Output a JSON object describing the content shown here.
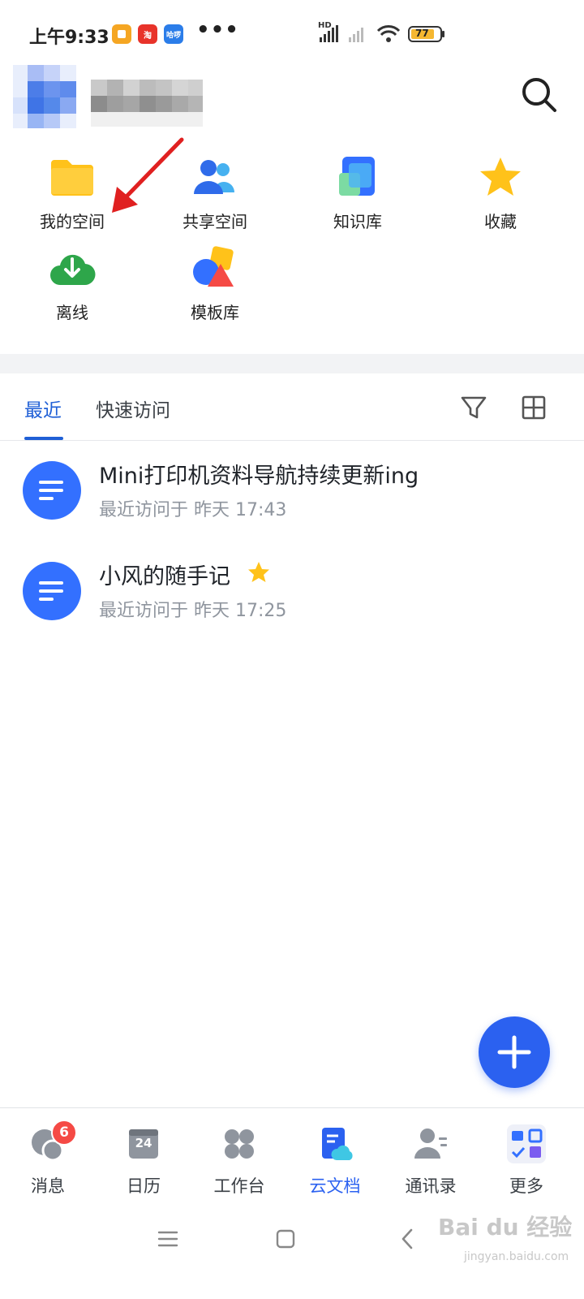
{
  "status_bar": {
    "time": "上午9:33",
    "apps": [
      "notes-app-icon",
      "taobao-app-icon",
      "haluo-app-icon"
    ],
    "app_labels": [
      "",
      "淘",
      "哈啰"
    ],
    "more": "•••",
    "network_label": "HD",
    "battery": "77"
  },
  "header": {
    "avatar_icon": "avatar-pixelated",
    "username_icon": "username-pixelated"
  },
  "shortcuts": [
    {
      "label": "我的空间",
      "icon": "folder-icon"
    },
    {
      "label": "共享空间",
      "icon": "people-icon"
    },
    {
      "label": "知识库",
      "icon": "knowledge-base-icon"
    },
    {
      "label": "收藏",
      "icon": "star-icon"
    },
    {
      "label": "离线",
      "icon": "cloud-download-icon"
    },
    {
      "label": "模板库",
      "icon": "template-icon"
    }
  ],
  "tabs": {
    "recent": "最近",
    "quick_access": "快速访问"
  },
  "documents": [
    {
      "title": "Mini打印机资料导航持续更新ing",
      "subtitle": "最近访问于  昨天 17:43",
      "starred": false
    },
    {
      "title": "小风的随手记",
      "subtitle": "最近访问于  昨天 17:25",
      "starred": true
    }
  ],
  "bottom_nav": [
    {
      "label": "消息",
      "icon": "chat-icon",
      "badge": "6"
    },
    {
      "label": "日历",
      "icon": "calendar-icon",
      "day": "24"
    },
    {
      "label": "工作台",
      "icon": "workbench-icon"
    },
    {
      "label": "云文档",
      "icon": "cloud-doc-icon",
      "active": true
    },
    {
      "label": "通讯录",
      "icon": "contacts-icon"
    },
    {
      "label": "更多",
      "icon": "more-apps-icon"
    }
  ],
  "watermark": {
    "brand": "Bai du 经验",
    "url": "jingyan.baidu.com"
  },
  "colors": {
    "accent": "#2b61f0",
    "tab_active": "#1f5fd6",
    "badge": "#f54a45",
    "annotation_arrow": "#e02020"
  }
}
